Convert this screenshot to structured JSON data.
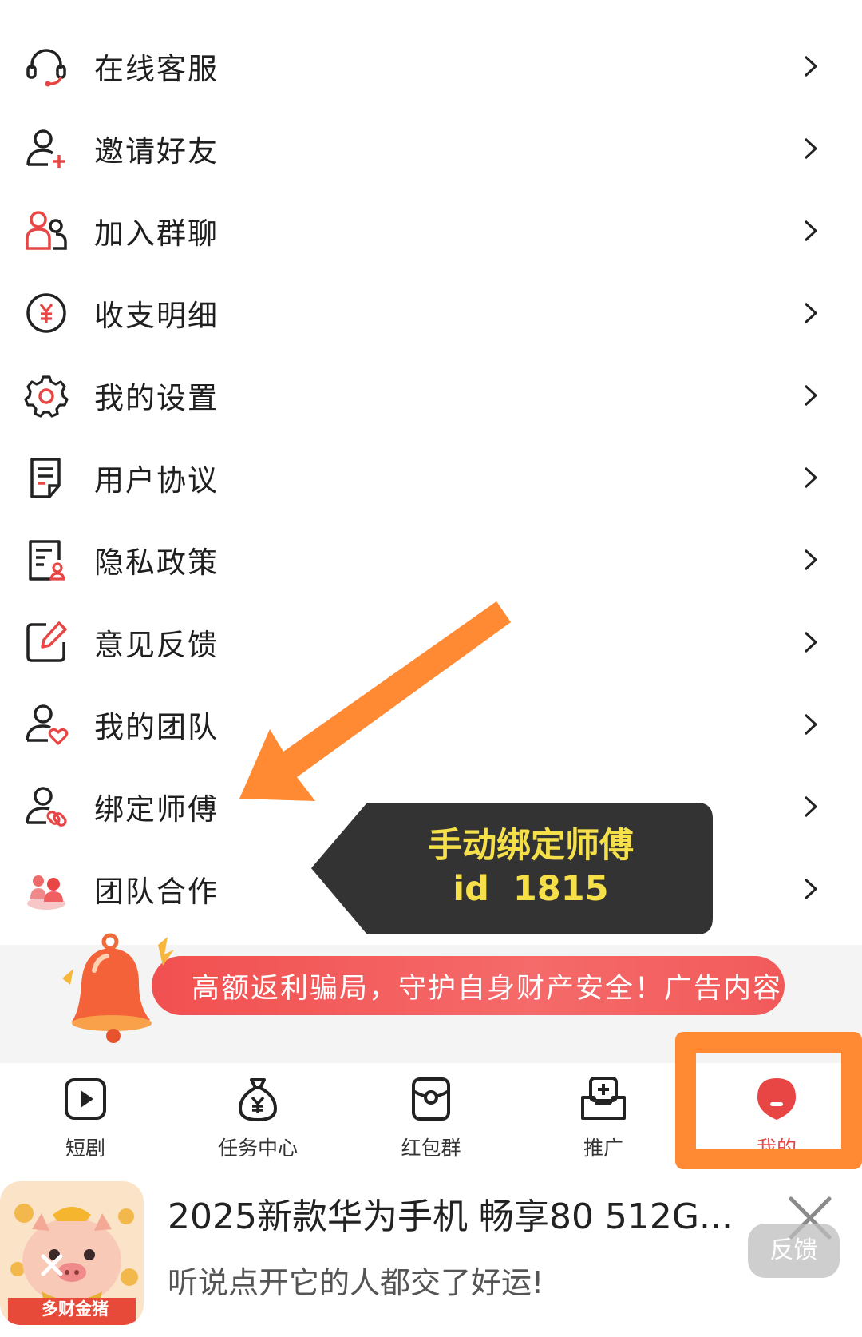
{
  "menu": {
    "items": [
      {
        "label": "在线客服",
        "icon": "headset-icon"
      },
      {
        "label": "邀请好友",
        "icon": "add-user-icon"
      },
      {
        "label": "加入群聊",
        "icon": "group-icon"
      },
      {
        "label": "收支明细",
        "icon": "yuan-coin-icon"
      },
      {
        "label": "我的设置",
        "icon": "gear-icon"
      },
      {
        "label": "用户协议",
        "icon": "document-icon"
      },
      {
        "label": "隐私政策",
        "icon": "privacy-document-icon"
      },
      {
        "label": "意见反馈",
        "icon": "edit-icon"
      },
      {
        "label": "我的团队",
        "icon": "user-heart-icon"
      },
      {
        "label": "绑定师傅",
        "icon": "user-link-icon"
      },
      {
        "label": "团队合作",
        "icon": "team-cooperation-icon"
      }
    ]
  },
  "annotation": {
    "line1": "手动绑定师傅",
    "line2": "id  1815",
    "colors": {
      "arrow": "#ff8a33",
      "callout_bg": "#333333",
      "callout_text": "#f6e04a"
    }
  },
  "notice": {
    "text": "高额返利骗局，守护自身财产安全！广告内容",
    "icon": "bell-icon"
  },
  "tabbar": {
    "tabs": [
      {
        "label": "短剧",
        "icon": "play-icon"
      },
      {
        "label": "任务中心",
        "icon": "money-bag-icon"
      },
      {
        "label": "红包群",
        "icon": "red-packet-icon"
      },
      {
        "label": "推广",
        "icon": "promotion-icon"
      },
      {
        "label": "我的",
        "icon": "profile-icon",
        "active": true
      }
    ],
    "accent": "#e84545"
  },
  "ad": {
    "thumb_label": "多财金猪",
    "title": "2025新款华为手机 畅享80 512G...",
    "subtitle": "听说点开它的人都交了好运!",
    "feedback_label": "反馈"
  }
}
